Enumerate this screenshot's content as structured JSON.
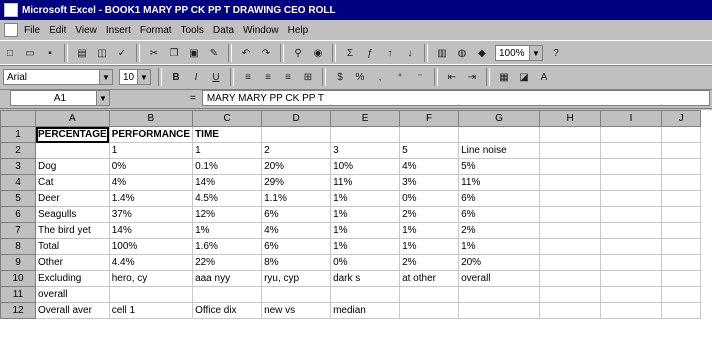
{
  "title": "Microsoft Excel - BOOK1 MARY PP CK PP T DRAWING CEO ROLL",
  "menu": [
    "File",
    "Edit",
    "View",
    "Insert",
    "Format",
    "Tools",
    "Data",
    "Window",
    "Help"
  ],
  "toolbar": {
    "zoom": "100%",
    "font_name": "Arial",
    "font_size": "10"
  },
  "formula_bar": {
    "name_box": "A1",
    "equals": "=",
    "content": "MARY MARY PP CK PP T"
  },
  "columns": [
    "A",
    "B",
    "C",
    "D",
    "E",
    "F",
    "G",
    "H",
    "I",
    "J"
  ],
  "rows": [
    {
      "n": "1",
      "cells": [
        "PERCENTAGE",
        "PERFORMANCE",
        "TIME",
        "",
        "",
        "",
        "",
        "",
        "",
        ""
      ]
    },
    {
      "n": "2",
      "cells": [
        "",
        "1",
        "1",
        "2",
        "3",
        "5",
        "Line noise",
        "",
        "",
        ""
      ]
    },
    {
      "n": "3",
      "cells": [
        "Dog",
        "0%",
        "0.1%",
        "20%",
        "10%",
        "4%",
        "5%",
        "",
        "",
        ""
      ]
    },
    {
      "n": "4",
      "cells": [
        "Cat",
        "4%",
        "14%",
        "29%",
        "11%",
        "3%",
        "11%",
        "",
        "",
        ""
      ]
    },
    {
      "n": "5",
      "cells": [
        "Deer",
        "1.4%",
        "4.5%",
        "1.1%",
        "1%",
        "0%",
        "6%",
        "",
        "",
        ""
      ]
    },
    {
      "n": "6",
      "cells": [
        "Seagulls",
        "37%",
        "12%",
        "6%",
        "1%",
        "2%",
        "6%",
        "",
        "",
        ""
      ]
    },
    {
      "n": "7",
      "cells": [
        "The bird yet",
        "14%",
        "1%",
        "4%",
        "1%",
        "1%",
        "2%",
        "",
        "",
        ""
      ]
    },
    {
      "n": "8",
      "cells": [
        "Total",
        "100%",
        "1.6%",
        "6%",
        "1%",
        "1%",
        "1%",
        "",
        "",
        ""
      ]
    },
    {
      "n": "9",
      "cells": [
        "Other",
        "4.4%",
        "22%",
        "8%",
        "0%",
        "2%",
        "20%",
        "",
        "",
        ""
      ]
    },
    {
      "n": "10",
      "cells": [
        "Excluding",
        "hero, cy",
        "aaa nyy",
        "ryu, cyp",
        "dark s",
        "at other",
        "overall",
        "",
        "",
        ""
      ]
    },
    {
      "n": "11",
      "cells": [
        "overall",
        "",
        "",
        "",
        "",
        "",
        "",
        "",
        "",
        ""
      ]
    },
    {
      "n": "12",
      "cells": [
        "Overall aver",
        "cell 1",
        "Office dix",
        "new vs",
        "median",
        "",
        "",
        "",
        "",
        ""
      ]
    }
  ]
}
